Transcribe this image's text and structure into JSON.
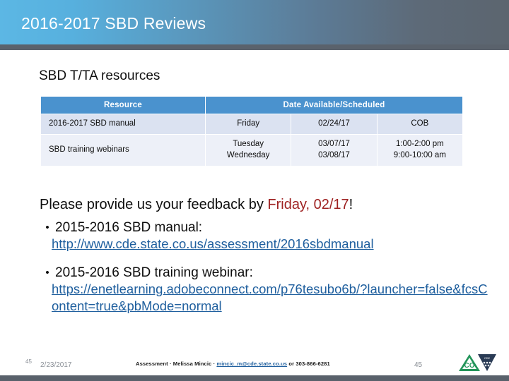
{
  "header": {
    "title": "2016-2017 SBD Reviews",
    "gradient_start": "#5cb7e4",
    "gradient_end": "#5c656f"
  },
  "content": {
    "heading": "SBD T/TA resources"
  },
  "table": {
    "header_bg": "#4a92ce",
    "columns": [
      "Resource",
      "Date Available/Scheduled"
    ],
    "rows": [
      {
        "resource": "2016-2017 SBD manual",
        "day": "Friday",
        "date": "02/24/17",
        "time": "COB"
      },
      {
        "resource": "SBD training webinars",
        "day": "Tuesday\nWednesday",
        "date": "03/07/17\n03/08/17",
        "time": "1:00-2:00 pm\n9:00-10:00 am"
      }
    ]
  },
  "feedback": {
    "lead": "Please provide us your feedback by ",
    "deadline": "Friday, 02/17",
    "trail": "!",
    "accent_color": "#9e2121"
  },
  "bullets": [
    {
      "bullet_char": "•",
      "label": "2015-2016 SBD manual:",
      "link": "http://www.cde.state.co.us/assessment/2016sbdmanual"
    },
    {
      "bullet_char": "•",
      "label": "2015-2016 SBD training webinar:",
      "link": "https://enetlearning.adobeconnect.com/p76tesubo6b/?launcher=false&fcsContent=true&pbMode=normal"
    }
  ],
  "footer": {
    "page_number_small": "45",
    "date": "2/23/2017",
    "credit_prefix": "Assessment · Melissa Mincic · ",
    "email": "mincic_m@cde.state.co.us",
    "credit_suffix": " or 303-866-6281",
    "page_number_right": "45",
    "logo_text": "CO",
    "logo_green": "#23955a",
    "logo_navy": "#2a3b55"
  }
}
